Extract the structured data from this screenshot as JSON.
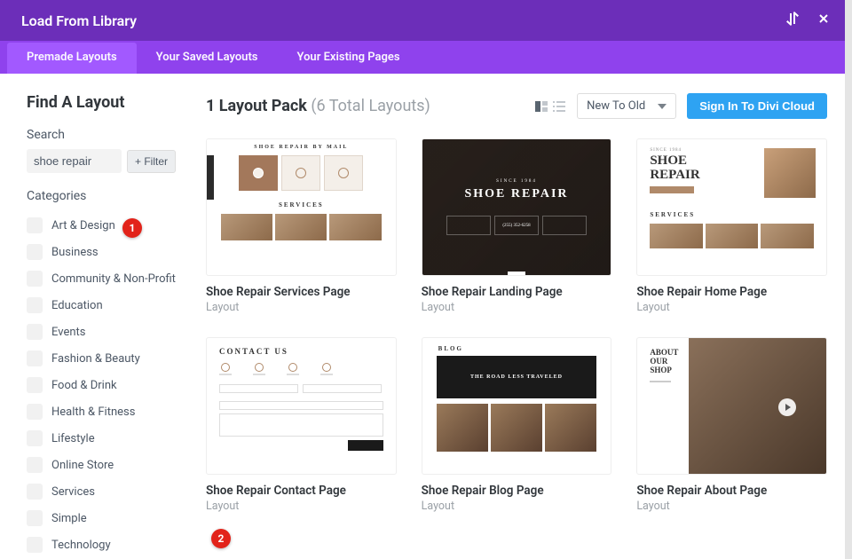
{
  "header": {
    "title": "Load From Library"
  },
  "tabs": {
    "items": [
      {
        "label": "Premade Layouts",
        "active": true
      },
      {
        "label": "Your Saved Layouts",
        "active": false
      },
      {
        "label": "Your Existing Pages",
        "active": false
      }
    ]
  },
  "sidebar": {
    "heading": "Find A Layout",
    "search_label": "Search",
    "search_value": "shoe repair",
    "filter_label": "+ Filter",
    "categories_label": "Categories",
    "categories": [
      "Art & Design",
      "Business",
      "Community & Non-Profit",
      "Education",
      "Events",
      "Fashion & Beauty",
      "Food & Drink",
      "Health & Fitness",
      "Lifestyle",
      "Online Store",
      "Services",
      "Simple",
      "Technology"
    ]
  },
  "main": {
    "title_prefix": "1 Layout Pack ",
    "title_suffix": "(6 Total Layouts)",
    "sort_value": "New To Old",
    "signin_label": "Sign In To Divi Cloud",
    "cards": [
      {
        "title": "Shoe Repair Services Page",
        "type": "Layout"
      },
      {
        "title": "Shoe Repair Landing Page",
        "type": "Layout"
      },
      {
        "title": "Shoe Repair Home Page",
        "type": "Layout"
      },
      {
        "title": "Shoe Repair Contact Page",
        "type": "Layout"
      },
      {
        "title": "Shoe Repair Blog Page",
        "type": "Layout"
      },
      {
        "title": "Shoe Repair About Page",
        "type": "Layout"
      }
    ]
  },
  "markers": {
    "m1": "1",
    "m2": "2"
  },
  "thumbs": {
    "t1": {
      "top": "SHOE REPAIR BY MAIL",
      "svc": "SERVICES"
    },
    "t2": {
      "since": "SINCE 1984",
      "title": "SHOE REPAIR",
      "phone": "(255) 352-6258"
    },
    "t3": {
      "since": "SINCE 1984",
      "l1": "SHOE",
      "l2": "REPAIR",
      "svc": "SERVICES"
    },
    "t4": {
      "title": "CONTACT US"
    },
    "t5": {
      "blog": "BLOG",
      "feature": "THE ROAD LESS TRAVELED"
    },
    "t6": {
      "l1": "ABOUT",
      "l2": "OUR SHOP"
    }
  }
}
